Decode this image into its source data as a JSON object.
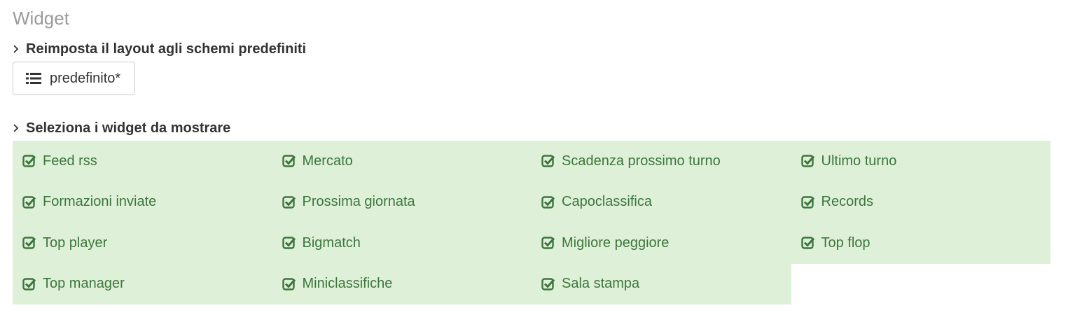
{
  "page": {
    "title": "Widget"
  },
  "layout_section": {
    "heading": "Reimposta il layout agli schemi predefiniti",
    "button_label": "predefinito*",
    "button_icon": "list-icon"
  },
  "widgets_section": {
    "heading": "Seleziona i widget da mostrare",
    "check_icon": "check-square-icon",
    "colors": {
      "background": "#dff0d8",
      "text": "#3c763d"
    },
    "items": [
      "Feed rss",
      "Mercato",
      "Scadenza prossimo turno",
      "Ultimo turno",
      "Formazioni inviate",
      "Prossima giornata",
      "Capoclassifica",
      "Records",
      "Top player",
      "Bigmatch",
      "Migliore peggiore",
      "Top flop",
      "Top manager",
      "Miniclassifiche",
      "Sala stampa"
    ]
  }
}
